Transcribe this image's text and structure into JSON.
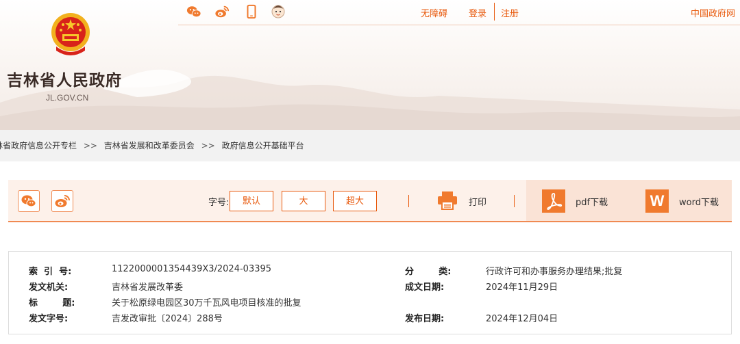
{
  "header": {
    "site_title": "吉林省人民政府",
    "site_domain": "JL.GOV.CN",
    "top_icons": [
      "wechat-icon",
      "weibo-icon",
      "mobile-icon",
      "assistant-avatar-icon"
    ],
    "links": {
      "accessibility": "无障碍",
      "login": "登录",
      "register": "注册",
      "china_gov": "中国政府网"
    }
  },
  "breadcrumb": {
    "items": [
      "林省政府信息公开专栏",
      "吉林省发展和改革委员会",
      "政府信息公开基础平台"
    ],
    "separator": ">>"
  },
  "toolbar": {
    "share_icons": [
      "wechat-icon",
      "weibo-icon"
    ],
    "font_size_label": "字号:",
    "font_sizes": [
      "默认",
      "大",
      "超大"
    ],
    "print_label": "打印",
    "pdf_label": "pdf下载",
    "word_label": "word下载",
    "word_letter": "W"
  },
  "info": {
    "index_no_label": "索  引  号:",
    "index_no": "1122000001354439X3/2024-03395",
    "category_label": "分        类:",
    "category": "行政许可和办事服务办理结果;批复",
    "issuer_label": "发文机关:",
    "issuer": "吉林省发展改革委",
    "written_date_label": "成文日期:",
    "written_date": "2024年11月29日",
    "title_label": "标        题:",
    "title": "关于松原绿电园区30万千瓦风电项目核准的批复",
    "doc_no_label": "发文字号:",
    "doc_no": "吉发改审批〔2024〕288号",
    "publish_date_label": "发布日期:",
    "publish_date": "2024年12月04日"
  },
  "colors": {
    "accent": "#e8590c",
    "toolbar_bg": "#fdf1ea",
    "download_bg": "#fae3d6",
    "breadcrumb_bg": "#f2f2f2"
  }
}
